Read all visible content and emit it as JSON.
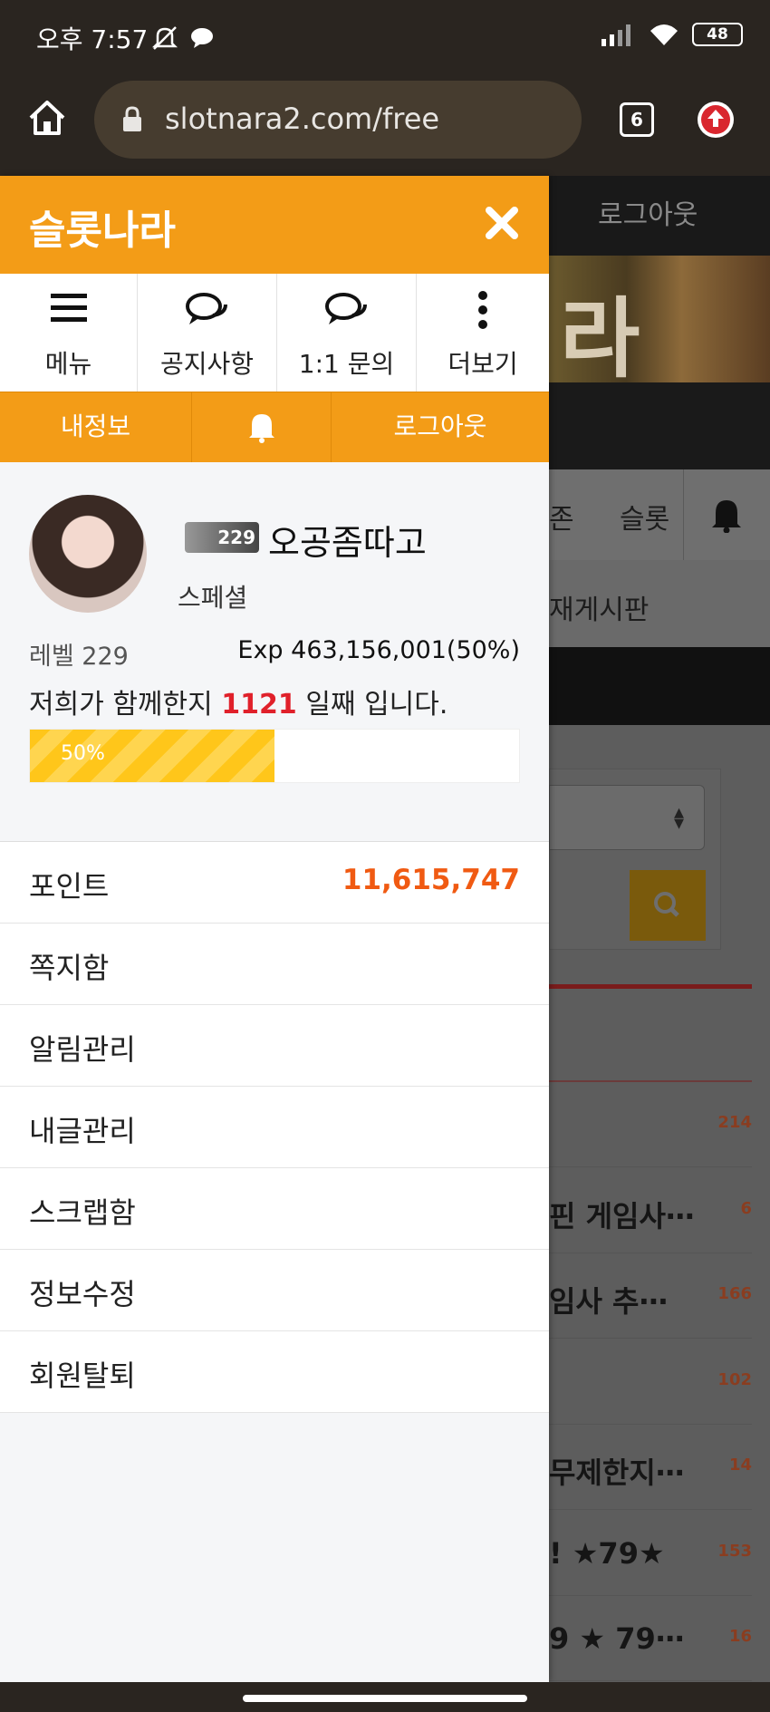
{
  "status": {
    "time": "오후 7:57",
    "battery": "48"
  },
  "browser": {
    "url": "slotnara2.com/free",
    "tab_count": "6"
  },
  "background_page": {
    "logout": "로그아웃",
    "banner_text": "라",
    "nav_a": "존",
    "nav_b": "슬롯",
    "sub_title": "재게시판",
    "posts": [
      {
        "title": "",
        "count": "214"
      },
      {
        "title": "핀 게임사⋯",
        "count": "6"
      },
      {
        "title": "임사 추⋯",
        "count": "166"
      },
      {
        "title": "",
        "count": "102"
      },
      {
        "title": "무제한지⋯",
        "count": "14"
      },
      {
        "title": "! ★79★",
        "count": "153"
      },
      {
        "title": "9 ★ 79⋯",
        "count": "16"
      }
    ]
  },
  "drawer": {
    "brand": "슬롯나라",
    "icons": [
      {
        "label": "메뉴",
        "icon": "hamburger-icon"
      },
      {
        "label": "공지사항",
        "icon": "chat-icon"
      },
      {
        "label": "1:1 문의",
        "icon": "chat-icon"
      },
      {
        "label": "더보기",
        "icon": "more-vertical-icon"
      }
    ],
    "tabs": {
      "myinfo": "내정보",
      "logout": "로그아웃"
    },
    "profile": {
      "level_badge": "229",
      "nickname": "오공좀따고",
      "grade": "스페셜",
      "level": "레벨 229",
      "exp": "Exp 463,156,001(50%)",
      "together_prefix": "저희가 함께한지",
      "together_days": "1121",
      "together_suffix": "일째 입니다.",
      "progress": 0.5,
      "progress_label": "50%"
    },
    "menu": {
      "points_label": "포인트",
      "points_value": "11,615,747",
      "items": [
        "쪽지함",
        "알림관리",
        "내글관리",
        "스크랩함",
        "정보수정",
        "회원탈퇴"
      ]
    }
  },
  "colors": {
    "accent": "#f39c17",
    "points": "#f05a12",
    "days": "#e0202a"
  }
}
